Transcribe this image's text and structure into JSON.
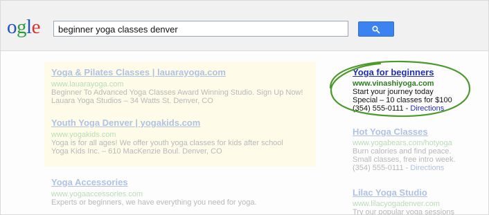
{
  "logo": {
    "text_o": "o",
    "text_g": "g",
    "text_l": "l",
    "text_e": "e"
  },
  "search": {
    "query": "beginner yoga classes denver"
  },
  "search_button": {
    "icon": "search-icon",
    "color": "#3b83f0"
  },
  "left_results": [
    {
      "title": "Yoga & Pilates Classes | lauarayoga.com",
      "url": "www.lauarayoga.com",
      "lines": [
        "Beginner To Advanced Yoga Classes Award Winning Studio. Sign Up Now!",
        "Lauara Yoga Studios – 34 Watts St. Denver, CO"
      ]
    },
    {
      "title": "Youth Yoga Denver | yogakids.com",
      "url": "www.yogakids.com",
      "lines": [
        "Yoga is for all ages! We offer youth yoga classes for kids after school",
        "Yoga Kids Inc. – 610 MacKenzie Boul. Denver, CO"
      ]
    },
    {
      "title": "Yoga Accessories",
      "url": "www.yogaaccessories.com",
      "lines": [
        "Experts or beginners, we have everything you need for yoga."
      ]
    }
  ],
  "right_ads": [
    {
      "title": "Yoga for beginners",
      "url": "www.vinashiyoga.com",
      "lines": [
        "Start your journey today",
        "Special – 10 classes for $100"
      ],
      "phone": "(354) 555-0111 - ",
      "link": "Directions"
    },
    {
      "title": "Hot Yoga Classes",
      "url": "www.yogabears.com/hotyoga",
      "lines": [
        "Burn calories and find peace.",
        "Small classes, free intro week."
      ],
      "phone": "(354) 555-0111 - ",
      "link": "Directions"
    },
    {
      "title": "Lilac Yoga Studio",
      "url": "www.lilacyogadenver.com",
      "lines": [
        "Try our popular yoga sessions"
      ]
    }
  ],
  "colors": {
    "highlight_circle": "#4c9a2a",
    "ad_background": "#fefce9"
  }
}
